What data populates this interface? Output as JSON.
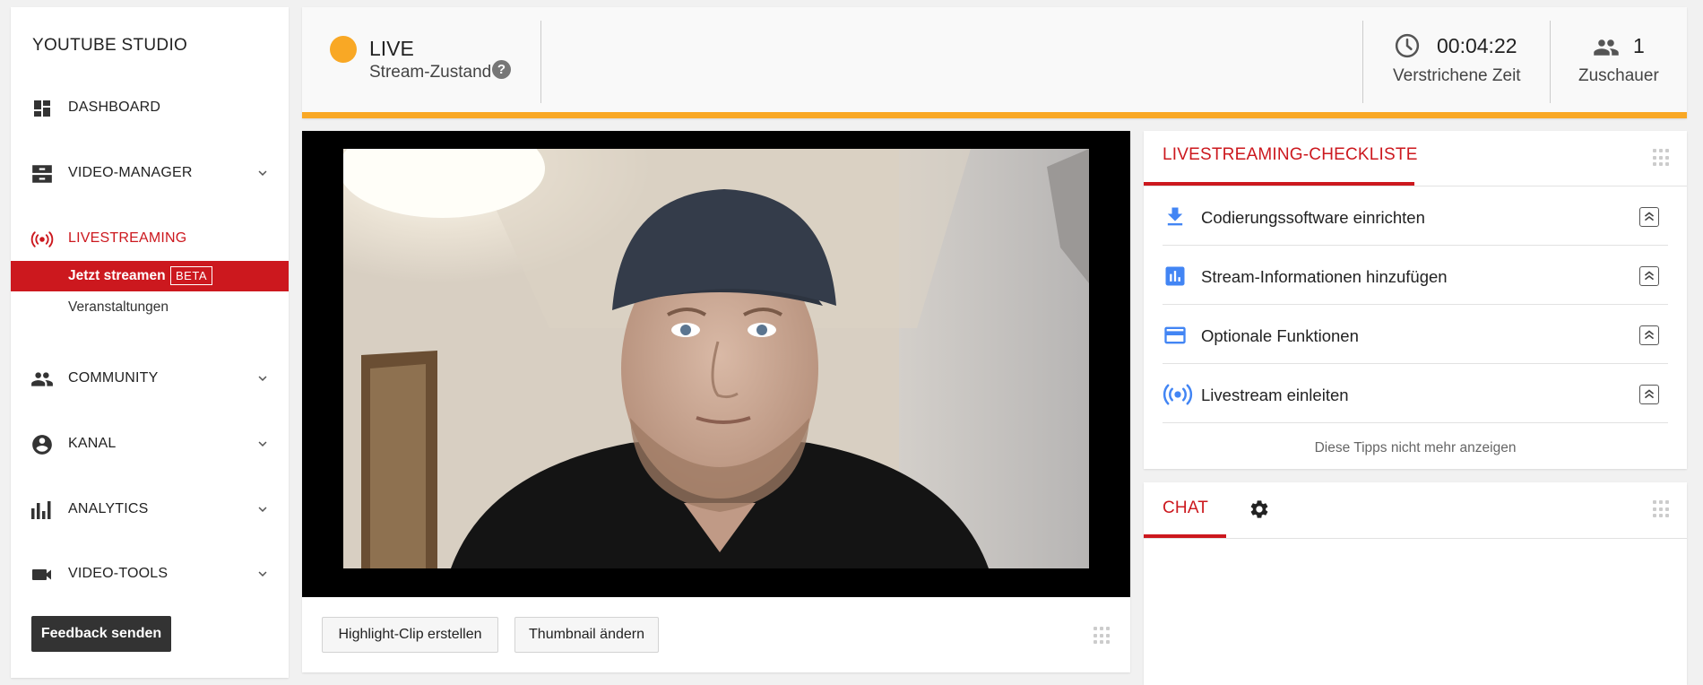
{
  "sidebar": {
    "brand": "YOUTUBE STUDIO",
    "items": [
      {
        "label": "DASHBOARD",
        "icon": "dashboard-icon"
      },
      {
        "label": "VIDEO-MANAGER",
        "icon": "video-manager-icon"
      },
      {
        "label": "LIVESTREAMING",
        "icon": "livestream-icon",
        "active": true
      },
      {
        "label": "COMMUNITY",
        "icon": "people-icon"
      },
      {
        "label": "KANAL",
        "icon": "account-circle-icon"
      },
      {
        "label": "ANALYTICS",
        "icon": "bar-chart-icon"
      },
      {
        "label": "VIDEO-TOOLS",
        "icon": "videocam-icon"
      }
    ],
    "subitems": [
      {
        "label": "Jetzt streamen",
        "badge": "BETA",
        "active": true
      },
      {
        "label": "Veranstaltungen"
      }
    ],
    "feedback_label": "Feedback senden"
  },
  "status": {
    "live_label": "LIVE",
    "state_label": "Stream-Zustand",
    "help_glyph": "?",
    "elapsed_value": "00:04:22",
    "elapsed_label": "Verstrichene Zeit",
    "viewers_value": "1",
    "viewers_label": "Zuschauer"
  },
  "video": {
    "actions": [
      "Highlight-Clip erstellen",
      "Thumbnail ändern"
    ]
  },
  "checklist": {
    "title": "LIVESTREAMING-CHECKLISTE",
    "items": [
      {
        "label": "Codierungssoftware einrichten",
        "icon": "download-icon"
      },
      {
        "label": "Stream-Informationen hinzufügen",
        "icon": "stats-icon"
      },
      {
        "label": "Optionale Funktionen",
        "icon": "credit-card-icon"
      },
      {
        "label": "Livestream einleiten",
        "icon": "broadcast-icon"
      }
    ],
    "dismiss_label": "Diese Tipps nicht mehr anzeigen"
  },
  "chat": {
    "tab_label": "CHAT"
  },
  "colors": {
    "accent_red": "#cc181e",
    "live_orange": "#f9a825",
    "icon_blue": "#4285f4",
    "text_dark": "#222222"
  }
}
